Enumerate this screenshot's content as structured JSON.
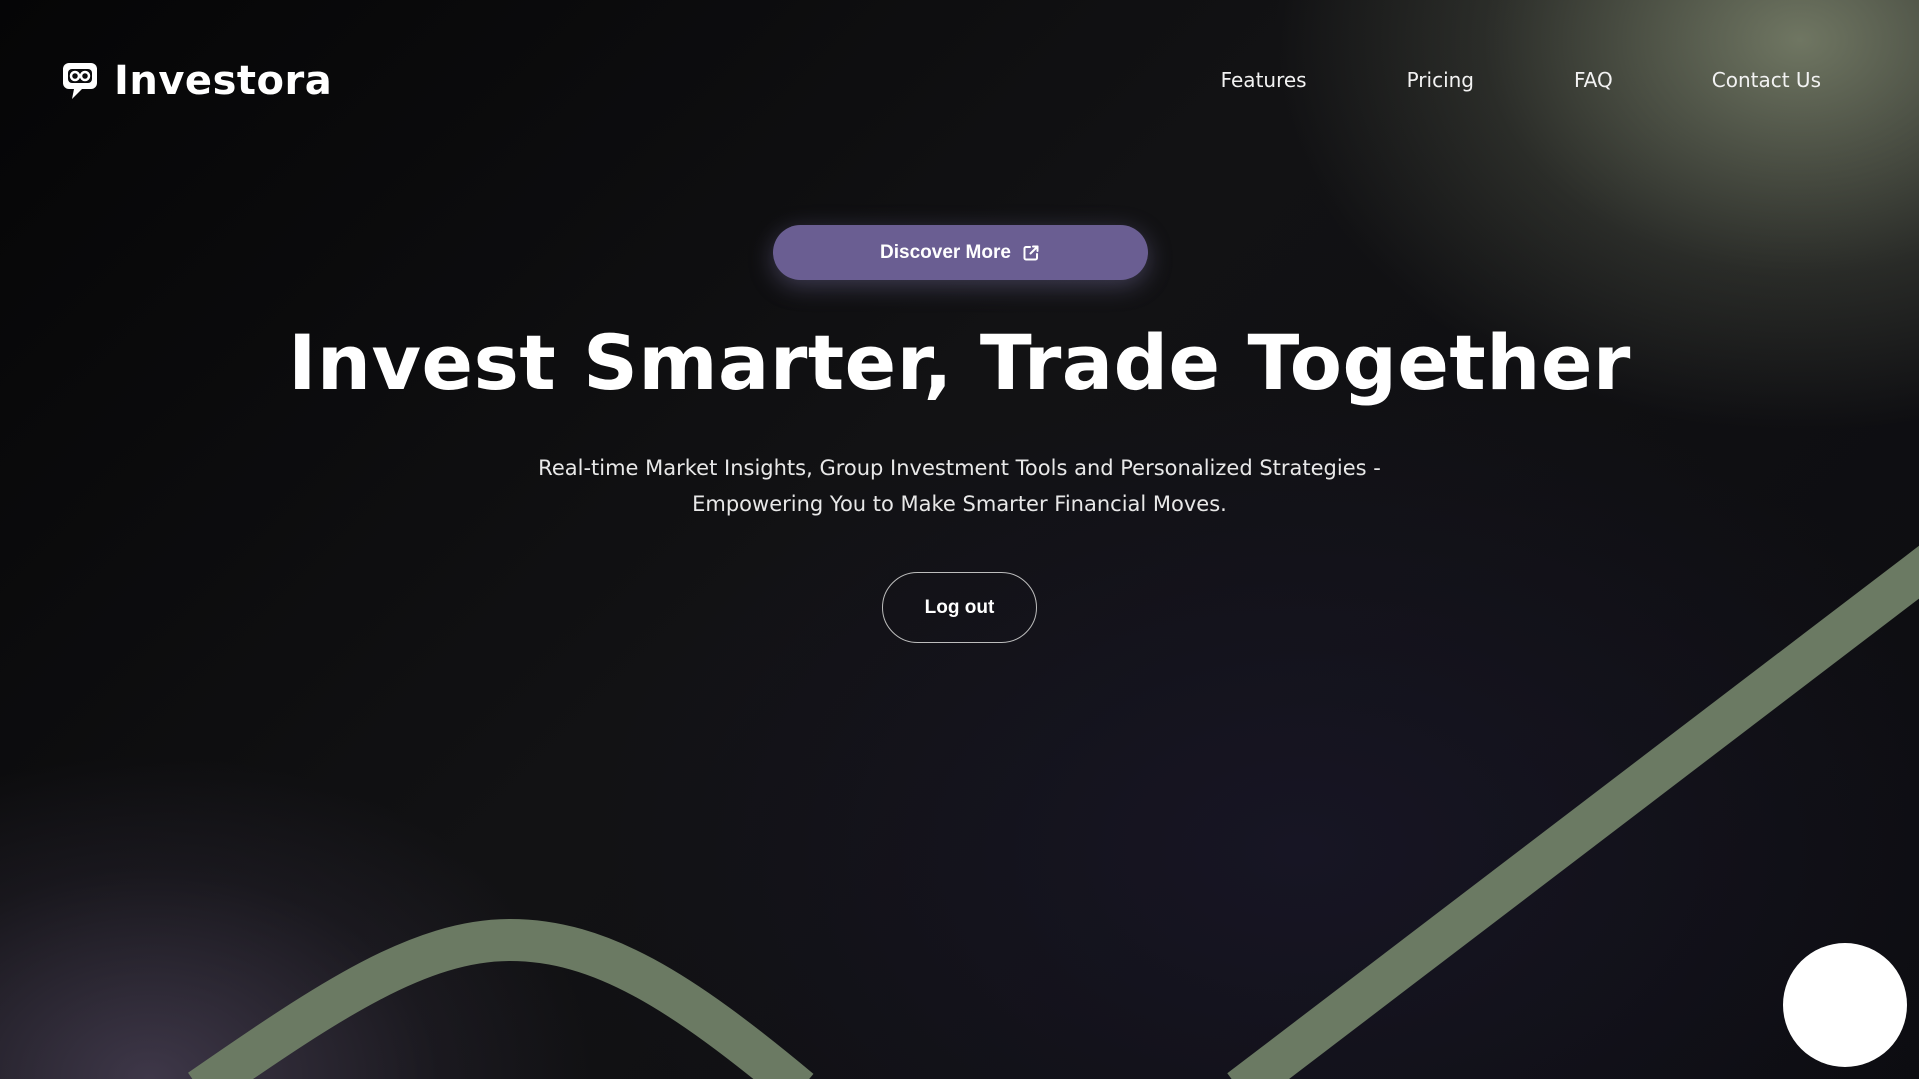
{
  "brand": {
    "name": "Investora",
    "logo_icon": "chat-link-logo-icon"
  },
  "nav": {
    "items": [
      {
        "label": "Features"
      },
      {
        "label": "Pricing"
      },
      {
        "label": "FAQ"
      },
      {
        "label": "Contact Us"
      }
    ]
  },
  "hero": {
    "cta_discover": {
      "label": "Discover More",
      "icon": "external-link-icon"
    },
    "title": "Invest Smarter, Trade Together",
    "subtitle_line1": "Real-time Market Insights, Group Investment Tools and Personalized Strategies -",
    "subtitle_line2": "Empowering You to Make Smarter Financial Moves.",
    "logout_label": "Log out"
  },
  "colors": {
    "accent": "#6a5e92",
    "curve": "#6b7a63",
    "background": "#0b0b0d"
  }
}
